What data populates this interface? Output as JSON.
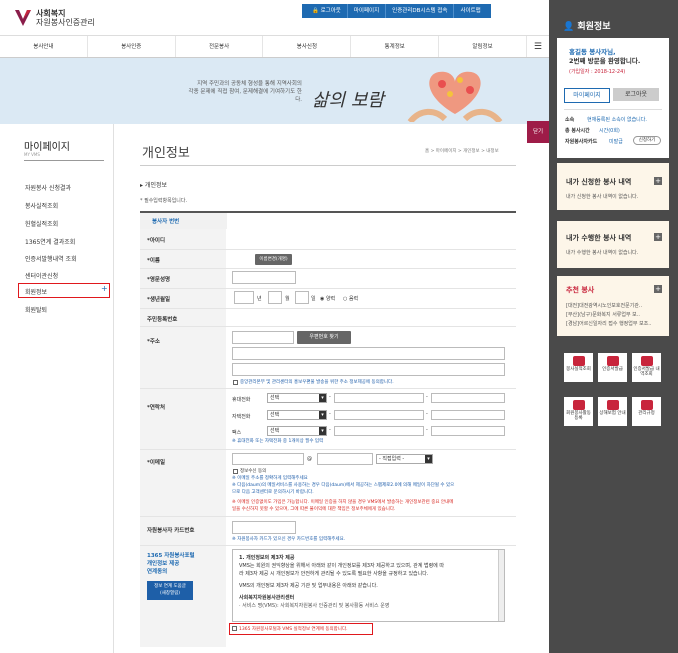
{
  "header": {
    "logo_line1": "사회복지",
    "logo_line2": "자원봉사인증관리",
    "util_links": [
      "로그아웃",
      "마이페이지",
      "인증관리DB시스템 접속",
      "사이트맵"
    ],
    "brand_color": "#1e6ab1"
  },
  "gnb": {
    "items": [
      "봉사안내",
      "봉사인증",
      "전문봉사",
      "봉사신청",
      "통계정보",
      "알림정보"
    ]
  },
  "banner": {
    "line1": "지역 주민과의 공동체 형성을 통해 지역사회의",
    "line2": "각종 문제에 직접 참여, 문제해결에 기여하기도 한다.",
    "title": "삶의 보람"
  },
  "lnb": {
    "title": "마이페이지",
    "subtitle": "MY VMS",
    "items": [
      "자원봉사 신청결과",
      "봉사실적조회",
      "헌혈실적조회",
      "1365연계 결과조회",
      "인증서발행내역 조회",
      "센터이관신청",
      "회원정보",
      "회원탈퇴"
    ],
    "active_plus": "+"
  },
  "page": {
    "title": "개인정보",
    "breadcrumb": "홈 > 마이페이지 > 개인정보 > 내정보",
    "section_title": "개인정보",
    "required_note": "* 필수입력항목입니다."
  },
  "form": {
    "id_label": "봉사자 번번",
    "userid_label": "*아이디",
    "name_label": "*이름",
    "name_btn": "이름변경(개명)",
    "eng_name_label": "*영문성명",
    "birth_label": "*생년월일",
    "birth_year": "년",
    "birth_month": "월",
    "birth_day": "일",
    "solar": "양력",
    "lunar": "음력",
    "resident_label": "주민등록번호",
    "address_label": "*주소",
    "zip_btn": "우편번호 찾기",
    "address_agree": "중앙관리본부 및 관리센터의 홍보우편물 발송을 위한 주소 정보제공에 동의합니다.",
    "contact_label": "*연락처",
    "phone_labels": [
      "휴대전화",
      "자택전화",
      "팩스"
    ],
    "select_default": "선택",
    "contact_note": "※ 휴대전화 또는 자택전화 중 1개이상 필수 입력",
    "email_label": "*이메일",
    "email_at": "@",
    "email_select": "- 직접입력 -",
    "email_agree": "정보수신 동의",
    "email_notes_blue": [
      "※ 이메일 주소를 정확하게 입력해주세요",
      "※ 다음(daum)의 메일서비스를 사용하는 경우 다음(daum)에서 제공하는 스팸제로2.0에 의해 메일이 차단될 수 있으",
      "므로 다음 고객센터로 문의하시기 바랍니다."
    ],
    "email_notes_red": [
      "※ 이메일 인증없이도 가입은 가능합니다. 이메일 인증을 하지 않을 경우 VMS에서 발송하는 개인정보관련 중요 안내메",
      "일을 수신하지 못할 수 있으며, 그에 따른 불이익에 대한 책임은 정보주체에게 있습니다."
    ],
    "card_label": "자원봉사자 카드번호",
    "card_note": "※ 자원봉사자 카드가 있으신 경우 카드번호를 입력해주세요.",
    "portal_label_1": "1365 자원봉사포털",
    "portal_label_2": "개인정보 제공",
    "portal_label_3": "연계동의",
    "portal_btn_1": "정보 연계 도움글",
    "portal_btn_2": "(새창열림)",
    "terms_title": "1. 개인정보의 제3자 제공",
    "terms_body_1": "VMS는 회원의 권익향상을 위해서 아래와 같이 개인정보를 제3자 제공하고 있으며, 관계 법령에 따",
    "terms_body_2": "라 제3자 제공 시 개인정보가 안전하게 관리될 수 있도록 필요한 사항을 규정하고 있습니다.",
    "terms_body_3": "VMS의 개인정보 제3자 제공 기관 및 업무내용은 아래와 같습니다.",
    "terms_org": "사회복지자원봉사관리센터",
    "terms_cut": "· 서비스 명(VMS): 사회복지자원봉사 인증관리 및 봉사활동 서비스 운영",
    "portal_agree": "1365 자원봉사포털과 VMS 실적정보 연계에 동의합니다."
  },
  "right_panel": {
    "title": "회원정보",
    "greeting_name": "홍길동 봉사자님,",
    "greeting_2": "2번째 방문을 환영합니다.",
    "join_date": "(가입일자 : 2018-12-24)",
    "btn_mypage": "마이페이지",
    "btn_logout": "로그아웃",
    "affil_label": "소속",
    "affil_value": "현재등록된 소속이 없습니다.",
    "hours_label": "총 봉사시간",
    "hours_value": "시간(0회)",
    "card_label": "자원봉사자카드",
    "card_value": "미발급",
    "card_btn": "신청하기",
    "applied_title": "내가 신청한 봉사 내역",
    "applied_empty": "내가 신청한 봉사 내역이 없습니다.",
    "done_title": "내가 수행한 봉사 내역",
    "done_empty": "내가 수행한 봉사 내역이 없습니다.",
    "rec_title": "추천 봉사",
    "rec_items": [
      "[대전]대전광역시노인보호전문기관..",
      "[부산](남구)문화복지 서류업무 보..",
      "[경남]어르신일자리 접수 행정업무 보조.."
    ],
    "quick_links": [
      "봉사실적조회",
      "인증서발급",
      "인증서발급 내역조회",
      "회원봉사활동 등록",
      "상해보험 안내",
      "관리규정"
    ],
    "close_label": "닫기",
    "accent": "#c8253c"
  }
}
